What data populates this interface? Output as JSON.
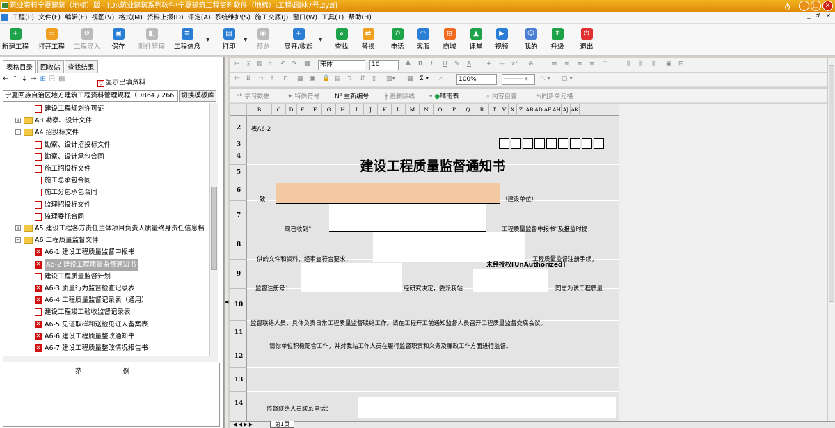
{
  "window": {
    "title": "筑业资料宁夏建筑（地标）版 - [D:\\筑业建筑系列软件\\宁夏建筑工程资料软件（地标）\\工程\\园林7号.zyzl]",
    "mdi_controls": "_ ♂ ×"
  },
  "menu": [
    "工程(P)",
    "文件(F)",
    "编辑(E)",
    "视图(V)",
    "格式(M)",
    "资料上报(D)",
    "评定(A)",
    "系统维护(S)",
    "施工交底(J)",
    "窗口(W)",
    "工具(T)",
    "帮助(H)"
  ],
  "toolbar": {
    "new_project": "新建工程",
    "open_project": "打开工程",
    "import_project": "工程导入",
    "save": "保存",
    "attachments": "附件管理",
    "project_info": "工程信息",
    "print": "打印",
    "preview": "预览",
    "expand_collapse": "展开/收起",
    "search": "查找",
    "replace": "替换",
    "phone": "电话",
    "service": "客服",
    "mall": "商城",
    "classroom": "课堂",
    "video": "视频",
    "mine": "我的",
    "upgrade": "升级",
    "exit": "退出"
  },
  "colors": {
    "title_bar": "#f0a418",
    "selected_row": "#a8a8a8",
    "input_highlight": "#f4c8a0",
    "doc_bg": "#e4e4e4"
  },
  "left_panel": {
    "tabs": [
      "表格目录",
      "回收站",
      "查找结果"
    ],
    "show_filled": "显示已填资料",
    "standard": "宁夏回族自治区地方建筑工程资料管理规程（DB64 / 266",
    "switch_template": "切换模板库",
    "example_label": "范 例"
  },
  "tree": [
    {
      "text": "建设工程规划许可证",
      "type": "doc",
      "level": 3
    },
    {
      "text": "A3 勘察、设计文件",
      "type": "folder",
      "level": 2,
      "expanded": false
    },
    {
      "text": "A4 招投标文件",
      "type": "folder",
      "level": 2,
      "expanded": true
    },
    {
      "text": "勘察、设计招投标文件",
      "type": "doc",
      "level": 3
    },
    {
      "text": "勘察、设计承包合同",
      "type": "doc",
      "level": 3
    },
    {
      "text": "施工招投标文件",
      "type": "doc",
      "level": 3
    },
    {
      "text": "施工总承包合同",
      "type": "doc",
      "level": 3
    },
    {
      "text": "施工分包承包合同",
      "type": "doc",
      "level": 3
    },
    {
      "text": "监理招投标文件",
      "type": "doc",
      "level": 3
    },
    {
      "text": "监理委托合同",
      "type": "doc",
      "level": 3
    },
    {
      "text": "A5 建设工程各方责任主体项目负责人质量终身责任信息档",
      "type": "folder",
      "level": 2,
      "expanded": false
    },
    {
      "text": "A6 工程质量监督文件",
      "type": "folder",
      "level": 2,
      "expanded": true
    },
    {
      "text": "A6-1 建设工程质量监督申报书",
      "type": "xdoc",
      "level": 3
    },
    {
      "text": "A6-2 建设工程质量监督通知书",
      "type": "xdoc",
      "level": 3,
      "selected": true
    },
    {
      "text": "建设工程质量监督计划",
      "type": "doc",
      "level": 3
    },
    {
      "text": "A6-3 质量行为监督检查记录表",
      "type": "xdoc",
      "level": 3
    },
    {
      "text": "A6-4 工程质量监督记录表（通用）",
      "type": "xdoc",
      "level": 3
    },
    {
      "text": "建设工程竣工验收监督记录表",
      "type": "doc",
      "level": 3
    },
    {
      "text": "A6-5 见证取样和送检见证人备案表",
      "type": "xdoc",
      "level": 3
    },
    {
      "text": "A6-6 建设工程质量整改通知书",
      "type": "xdoc",
      "level": 3
    },
    {
      "text": "A6-7 建设工程质量整改情况报告书",
      "type": "xdoc",
      "level": 3
    }
  ],
  "format_bar": {
    "font_name": "宋体",
    "font_size": "10",
    "zoom": "100%"
  },
  "ribbon3": {
    "study_data": "学习数据",
    "special_symbols": "特殊符号",
    "renumber": "重新编号",
    "draw_slash": "画删除线",
    "rain_table": "晴雨表",
    "self_check": "内容自查",
    "sync_cells": "同步单元格"
  },
  "columns": [
    "B",
    "C",
    "D",
    "E",
    "F",
    "G",
    "H",
    "I",
    "J",
    "K",
    "L",
    "M",
    "N",
    "O",
    "P",
    "Q",
    "R",
    "T",
    "V",
    "X",
    "Z",
    "AB",
    "AD",
    "AF",
    "AH",
    "AJ",
    "AK"
  ],
  "rows": [
    "2",
    "3",
    "4",
    "5",
    "6",
    "7",
    "8",
    "9",
    "10",
    "11",
    "12",
    "13",
    "14"
  ],
  "document": {
    "form_no": "表A6-2",
    "title": "建设工程质量监督通知书",
    "to_label": "致：",
    "to_suffix": "（建设单位）",
    "line1_a": "现已收到“",
    "line1_b": "工程质量监督申报书”及报监时提",
    "line2_a": "供的文件和资料，经审查符合要求，",
    "line2_b": "工程质量监督注册手续，",
    "watermark": "未经授权[UnAuthorized]",
    "line3_a": "监督注册号：",
    "line3_b": "经研究决定，委派我站",
    "line3_c": "同志为该工程质量",
    "line4": "监督联络人员，具体负责日常工程质量监督联络工作。请在工程开工前通知监督人员召开工程质量监督交底会议。",
    "line5": "请你单位积极配合工作，并对我站工作人员在履行监督职责和义务及廉政工作方面进行监督。",
    "phone_label": "监督联络人员联系电话："
  },
  "sheet_tab": "第1页"
}
